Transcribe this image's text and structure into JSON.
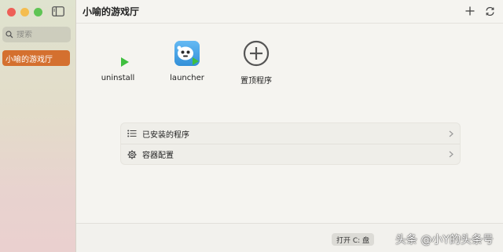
{
  "sidebar": {
    "search": {
      "placeholder": "搜索"
    },
    "items": [
      {
        "label": "小喻的游戏厅",
        "selected": true
      }
    ]
  },
  "header": {
    "title": "小喻的游戏厅"
  },
  "apps": [
    {
      "label": "uninstall",
      "icon": "play-icon"
    },
    {
      "label": "launcher",
      "icon": "launcher-app-icon"
    },
    {
      "label": "置顶程序",
      "icon": "add-circle-icon"
    }
  ],
  "list": [
    {
      "label": "已安装的程序",
      "icon": "list-icon"
    },
    {
      "label": "容器配置",
      "icon": "gear-icon"
    }
  ],
  "footer": {
    "open_c_label": "打开 C: 盘",
    "watermark": "头条 @小Y的头条号"
  },
  "colors": {
    "accent": "#d4702f",
    "play_green": "#3fbf3f",
    "launcher_blue": "#3aa0e8"
  }
}
